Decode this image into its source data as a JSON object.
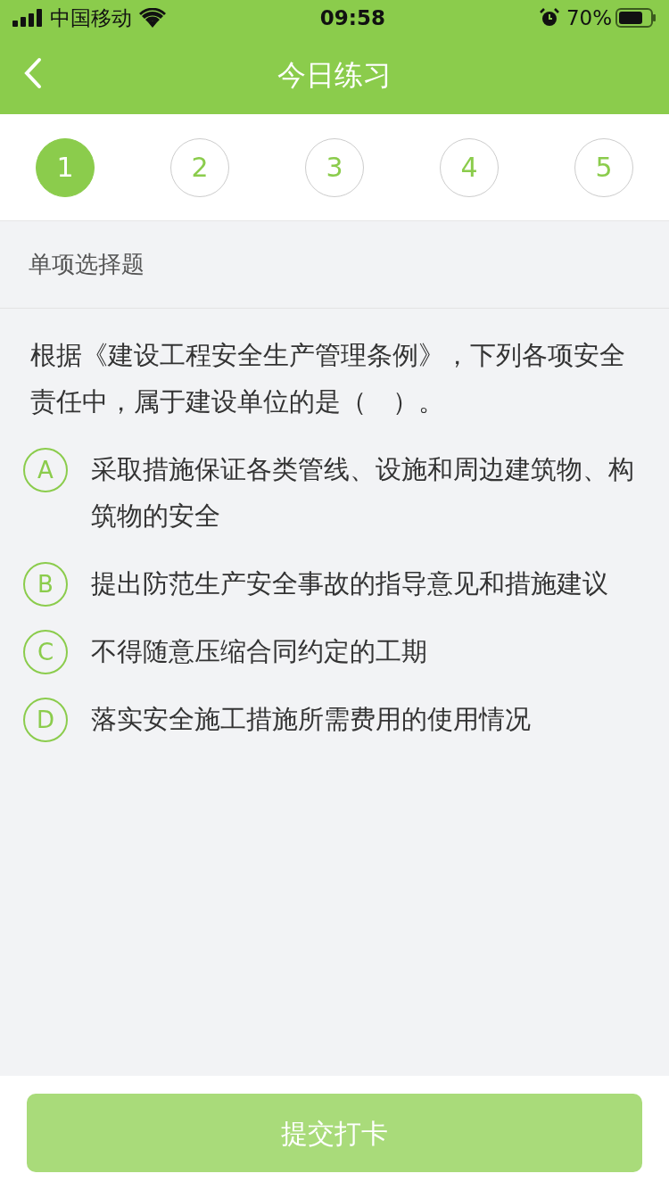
{
  "status_bar": {
    "carrier": "中国移动",
    "time": "09:58",
    "battery": "70%"
  },
  "nav": {
    "title": "今日练习"
  },
  "steps": [
    {
      "label": "1",
      "selected": true
    },
    {
      "label": "2",
      "selected": false
    },
    {
      "label": "3",
      "selected": false
    },
    {
      "label": "4",
      "selected": false
    },
    {
      "label": "5",
      "selected": false
    }
  ],
  "section": {
    "title": "单项选择题"
  },
  "question": {
    "text": "根据《建设工程安全生产管理条例》，下列各项安全责任中，属于建设单位的是（　）。",
    "options": [
      {
        "letter": "A",
        "text": "采取措施保证各类管线、设施和周边建筑物、构筑物的安全",
        "selected": false
      },
      {
        "letter": "B",
        "text": "提出防范生产安全事故的指导意见和措施建议",
        "selected": false
      },
      {
        "letter": "C",
        "text": "不得随意压缩合同约定的工期",
        "selected": false
      },
      {
        "letter": "D",
        "text": "落实安全施工措施所需费用的使用情况",
        "selected": false
      }
    ]
  },
  "submit": {
    "label": "提交打卡",
    "disabled": true
  }
}
